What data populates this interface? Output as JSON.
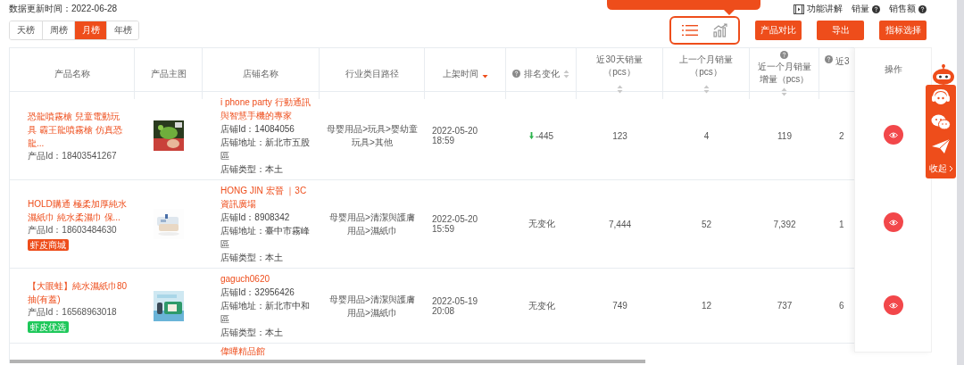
{
  "update_time": "数据更新时间：2022-06-28",
  "top_links": [
    {
      "kind": "video",
      "label": "功能讲解"
    },
    {
      "kind": "help",
      "label": "销量"
    },
    {
      "kind": "help",
      "label": "销售额"
    }
  ],
  "period_tabs": [
    {
      "label": "天榜",
      "selected": false
    },
    {
      "label": "周榜",
      "selected": false
    },
    {
      "label": "月榜",
      "selected": true
    },
    {
      "label": "年榜",
      "selected": false
    }
  ],
  "view_toggle": [
    {
      "kind": "list",
      "selected": true
    },
    {
      "kind": "chart",
      "selected": false
    }
  ],
  "buttons": [
    "产品对比",
    "导出",
    "指标选择"
  ],
  "table": {
    "columns": [
      {
        "label": "产品名称",
        "help": false,
        "sortable": false
      },
      {
        "label": "产品主图",
        "help": false,
        "sortable": false
      },
      {
        "label": "店铺名称",
        "help": false,
        "sortable": false
      },
      {
        "label": "行业类目路径",
        "help": false,
        "sortable": false
      },
      {
        "label": "上架时间",
        "help": false,
        "sortable": true,
        "sorted_desc": true
      },
      {
        "label": "排名变化",
        "help": true,
        "sortable": true,
        "sorted_desc": false
      },
      {
        "label": "近30天销量（pcs）",
        "help": false,
        "sortable": true,
        "sorted_desc": false
      },
      {
        "label": "上一个月销量（pcs）",
        "help": false,
        "sortable": true,
        "sorted_desc": false
      },
      {
        "label": "近一个月销量增量（pcs）",
        "help": true,
        "sortable": true,
        "sorted_desc": false
      },
      {
        "label": "近3",
        "help": true,
        "sortable": false
      }
    ],
    "action_column": "操作",
    "rows": [
      {
        "product_name": "恐龍噴霧槍 兒童電動玩具 霸王龍噴霧槍 仿真恐龍...",
        "product_id": "产品Id：18403541267",
        "shop_name": "i phone party 行動通訊與智慧手機的專家",
        "shop_id": "店铺Id：14084056",
        "shop_address": "店铺地址：新北市五股區",
        "shop_type": "店铺类型：本土",
        "category": "母婴用品>玩具>婴幼童玩具>其他",
        "listed": "2022-05-20 18:59",
        "rank_change": {
          "kind": "down",
          "text": "-445"
        },
        "sales_30d": "123",
        "sales_last_month": "4",
        "growth": "119",
        "column_10": "2"
      },
      {
        "product_name": "HOLD購通 極柔加厚純水濕紙巾 純水柔濕巾 保...",
        "product_id": "产品Id：18603484630",
        "tag": {
          "label": "虾皮商城",
          "color": "#ee4d1b"
        },
        "shop_name": "HONG JIN 宏晉 ｜3C資訊廣場",
        "shop_id": "店铺Id：8908342",
        "shop_address": "店铺地址：臺中市霧峰區",
        "shop_type": "店铺类型：本土",
        "category": "母婴用品>清潔與護膚用品>濕紙巾",
        "listed": "2022-05-20 15:59",
        "rank_change": {
          "kind": "none",
          "text": "无变化"
        },
        "sales_30d": "7,444",
        "sales_last_month": "52",
        "growth": "7,392",
        "column_10": "1"
      },
      {
        "product_name": "【大眼蛙】純水濕紙巾80抽(有蓋)",
        "product_id": "产品Id：16568963018",
        "tag": {
          "label": "虾皮优选",
          "color": "#1ec85a"
        },
        "shop_name": "gaguch0620",
        "shop_id": "店铺Id：32956426",
        "shop_address": "店铺地址：新北市中和區",
        "shop_type": "店铺类型：本土",
        "category": "母婴用品>清潔與護膚用品>濕紙巾",
        "listed": "2022-05-19 20:08",
        "rank_change": {
          "kind": "none",
          "text": "无变化"
        },
        "sales_30d": "749",
        "sales_last_month": "12",
        "growth": "737",
        "column_10": "6"
      }
    ],
    "partial_row": {
      "shop_name": "偉曄精品館"
    }
  },
  "side_panel": {
    "collapse": "收起"
  }
}
